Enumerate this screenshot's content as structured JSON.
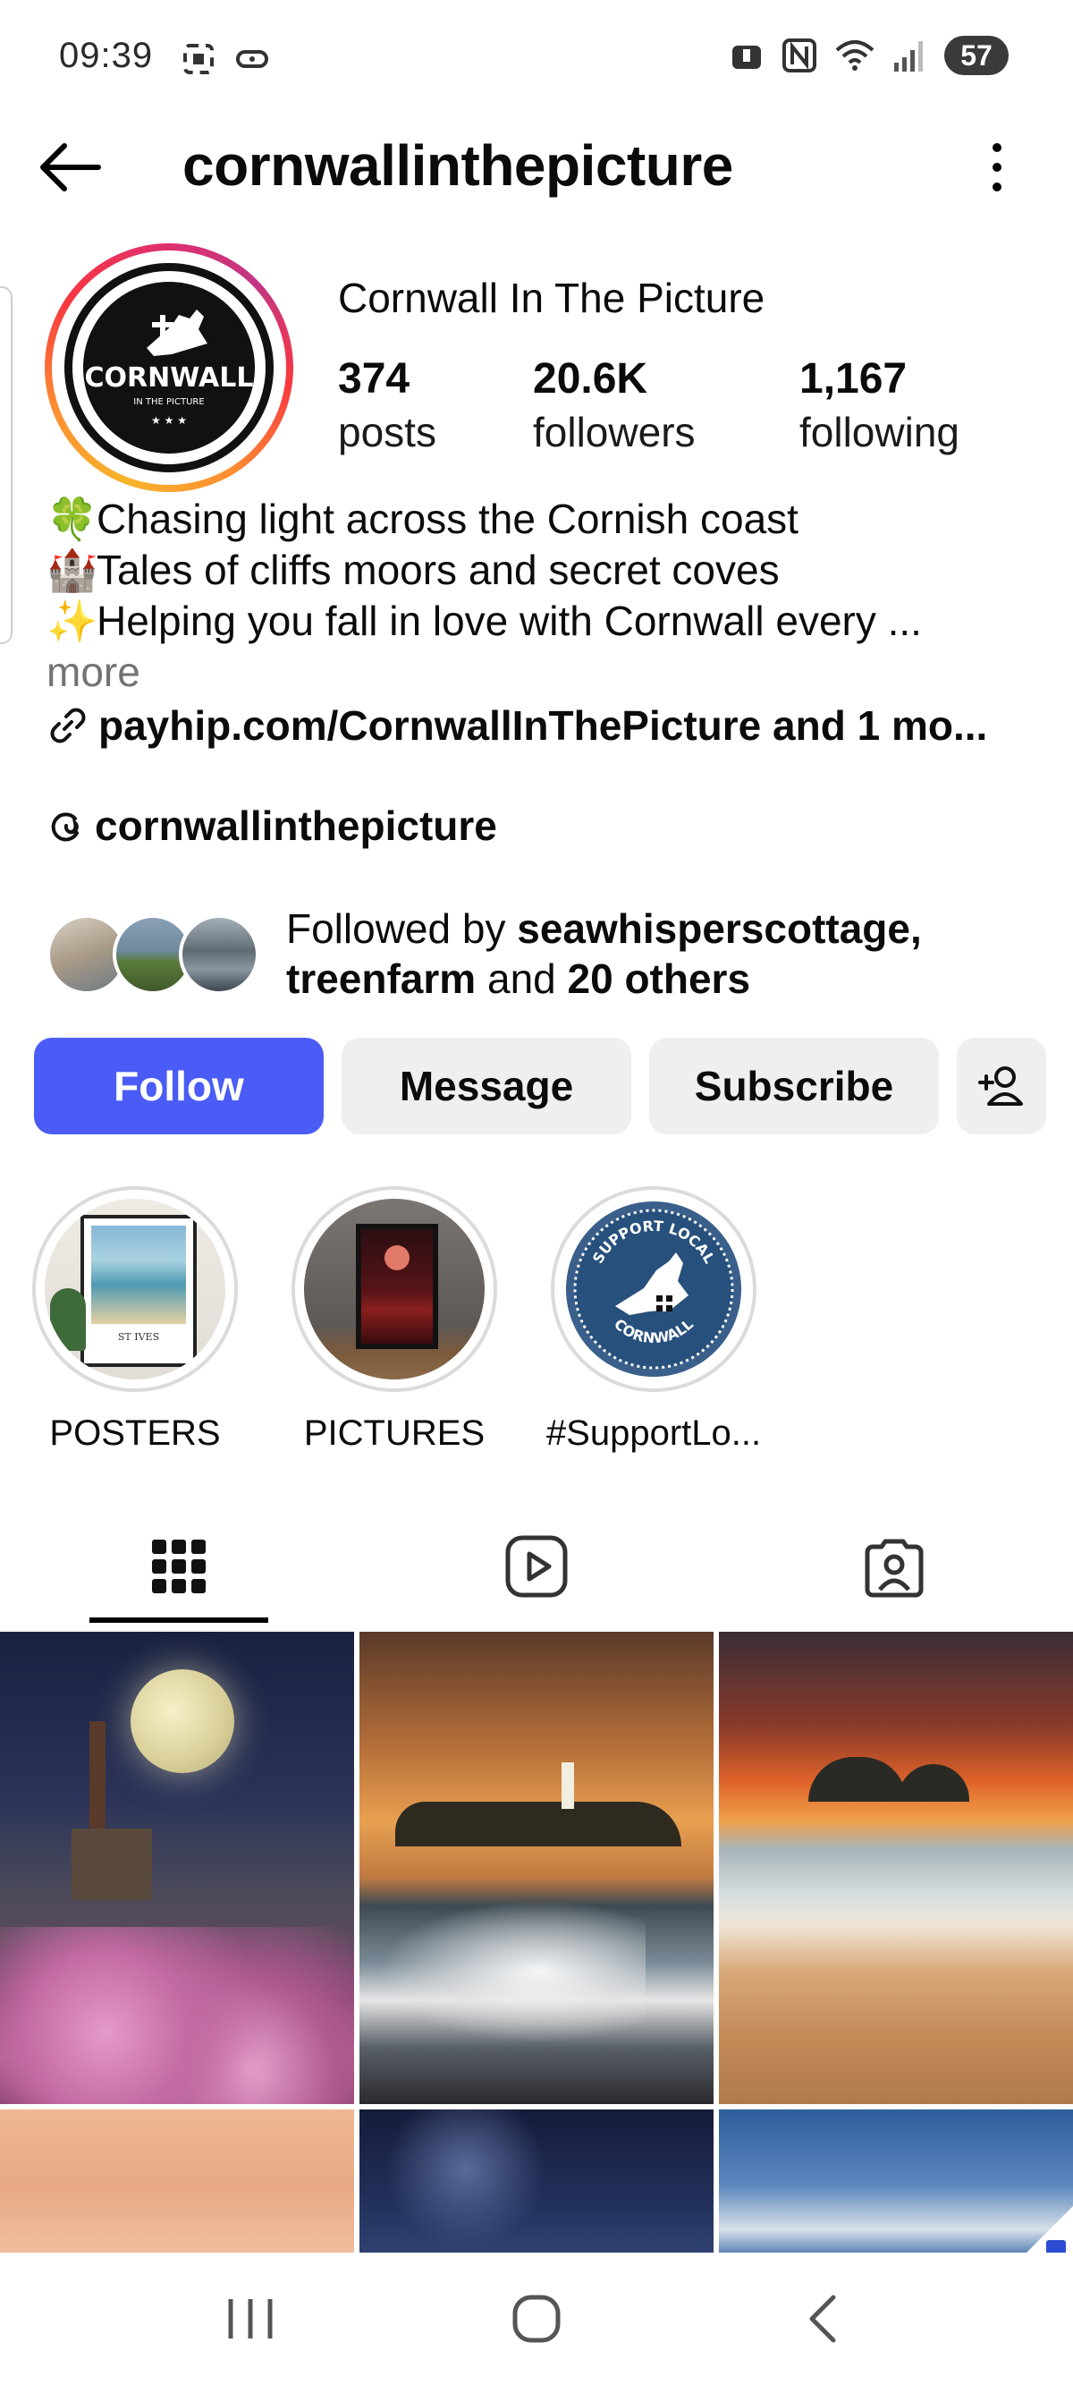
{
  "status_bar": {
    "time": "09:39",
    "battery": "57"
  },
  "header": {
    "username": "cornwallinthepicture"
  },
  "profile": {
    "display_name": "Cornwall In The Picture",
    "stats": [
      {
        "value": "374",
        "label": "posts"
      },
      {
        "value": "20.6K",
        "label": "followers"
      },
      {
        "value": "1,167",
        "label": "following"
      }
    ],
    "bio": [
      {
        "emoji": "🍀",
        "text": "Chasing light across the Cornish coast"
      },
      {
        "emoji": "🏰",
        "text": "Tales of cliffs moors and secret coves"
      },
      {
        "emoji": "✨",
        "text": "Helping you fall in love with Cornwall every ..."
      }
    ],
    "more_label": "more",
    "link_text": "payhip.com/CornwallInThePicture and 1 mo...",
    "threads_handle": "cornwallinthepicture",
    "followed_by": {
      "prefix": "Followed by ",
      "user1": "seawhisperscottage",
      "comma": ",",
      "user2": "treenfarm",
      "middle": " and ",
      "others": "20 others"
    }
  },
  "actions": {
    "follow": "Follow",
    "message": "Message",
    "subscribe": "Subscribe"
  },
  "highlights": [
    {
      "label": "POSTERS"
    },
    {
      "label": "PICTURES"
    },
    {
      "label": "#SupportLo..."
    }
  ],
  "badge_text": {
    "support_local": "SUPPORT LOCAL",
    "cornwall": "CORNWALL",
    "avatar_logo": "CORNWALL",
    "avatar_sub": "IN THE PICTURE",
    "st_ives": "ST IVES"
  },
  "colors": {
    "follow_button": "#4a5cf5",
    "button_bg": "#efefef"
  }
}
